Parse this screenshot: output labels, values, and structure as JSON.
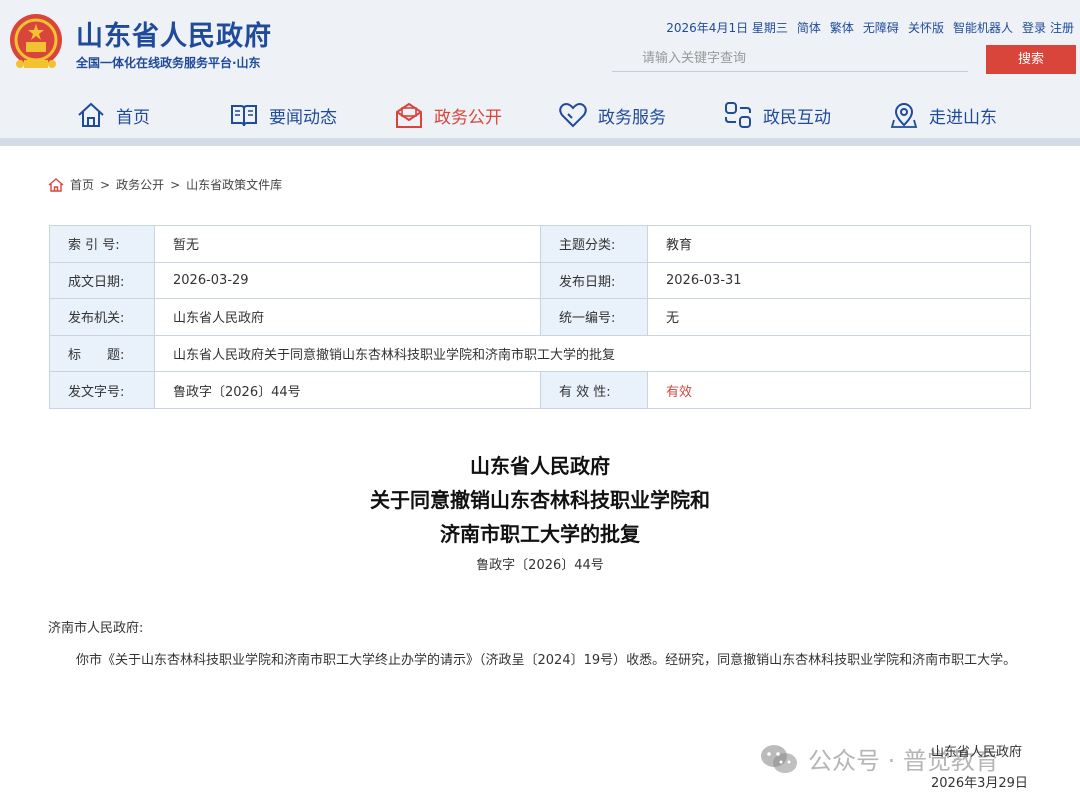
{
  "header": {
    "title": "山东省人民政府",
    "subtitle": "全国一体化在线政务服务平台·山东",
    "date": "2026年4月1日 星期三",
    "links": [
      "简体",
      "繁体",
      "无障碍",
      "关怀版",
      "智能机器人"
    ],
    "login": "登录",
    "register": "注册",
    "search_placeholder": "请输入关键字查询",
    "search_button": "搜索",
    "brand_red": "#d9453a",
    "brand_blue": "#1f4b9a"
  },
  "nav": [
    {
      "label": "首页",
      "icon": "home-icon"
    },
    {
      "label": "要闻动态",
      "icon": "book-icon"
    },
    {
      "label": "政务公开",
      "icon": "mail-open-icon",
      "active": true
    },
    {
      "label": "政务服务",
      "icon": "heart-icon"
    },
    {
      "label": "政民互动",
      "icon": "interaction-icon"
    },
    {
      "label": "走进山东",
      "icon": "location-icon"
    }
  ],
  "breadcrumb": [
    "首页",
    "政务公开",
    "山东省政策文件库"
  ],
  "info": {
    "index_label": "索 引 号:",
    "index_value": "暂无",
    "topic_label": "主题分类:",
    "topic_value": "教育",
    "written_label": "成文日期:",
    "written_value": "2026-03-29",
    "published_label": "发布日期:",
    "published_value": "2026-03-31",
    "issuer_label": "发布机关:",
    "issuer_value": "山东省人民政府",
    "serial_label": "统一编号:",
    "serial_value": "无",
    "title_label": "标　　题:",
    "title_value": "山东省人民政府关于同意撤销山东杏林科技职业学院和济南市职工大学的批复",
    "docno_label": "发文字号:",
    "docno_value": "鲁政字〔2026〕44号",
    "validity_label": "有 效 性:",
    "validity_value": "有效"
  },
  "document": {
    "title_line1": "山东省人民政府",
    "title_line2": "关于同意撤销山东杏林科技职业学院和",
    "title_line3": "济南市职工大学的批复",
    "doc_number": "鲁政字〔2026〕44号",
    "addressee": "济南市人民政府:",
    "body": "你市《关于山东杏林科技职业学院和济南市职工大学终止办学的请示》（济政呈〔2024〕19号）收悉。经研究，同意撤销山东杏林科技职业学院和济南市职工大学。",
    "signature_org": "山东省人民政府",
    "signature_date": "2026年3月29日"
  },
  "watermark": {
    "text": "公众号 · 普觉教育",
    "icon": "wechat-icon"
  }
}
